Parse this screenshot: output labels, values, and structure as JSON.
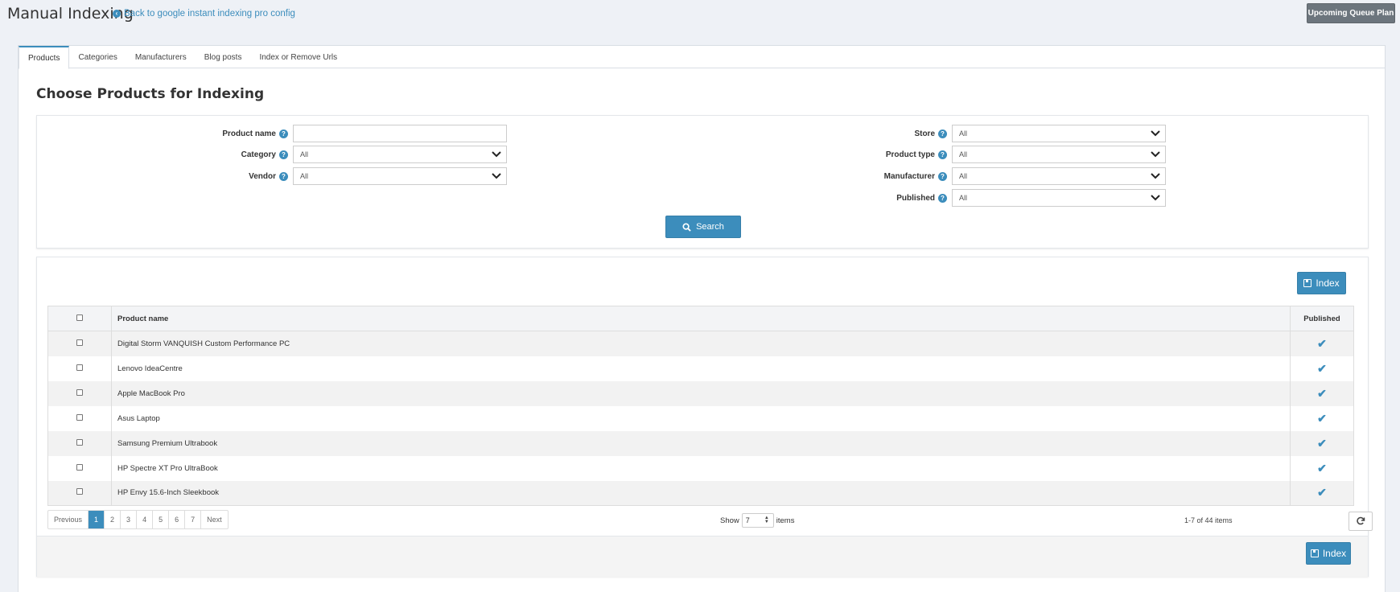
{
  "header": {
    "title": "Manual Indexing",
    "back_link": "Back to google instant indexing pro config",
    "queue_button": "Upcoming Queue Plan"
  },
  "tabs": [
    {
      "label": "Products"
    },
    {
      "label": "Categories"
    },
    {
      "label": "Manufacturers"
    },
    {
      "label": "Blog posts"
    },
    {
      "label": "Index or Remove Urls"
    }
  ],
  "section_title": "Choose Products for Indexing",
  "filters": {
    "product_name": {
      "label": "Product name",
      "value": ""
    },
    "category": {
      "label": "Category",
      "value": "All"
    },
    "vendor": {
      "label": "Vendor",
      "value": "All"
    },
    "store": {
      "label": "Store",
      "value": "All"
    },
    "product_type": {
      "label": "Product type",
      "value": "All"
    },
    "manufacturer": {
      "label": "Manufacturer",
      "value": "All"
    },
    "published": {
      "label": "Published",
      "value": "All"
    }
  },
  "search_button": "Search",
  "index_button": "Index",
  "table": {
    "columns": [
      "Product name",
      "Published"
    ],
    "rows": [
      {
        "name": "Digital Storm VANQUISH Custom Performance PC",
        "published": true
      },
      {
        "name": "Lenovo IdeaCentre",
        "published": true
      },
      {
        "name": "Apple MacBook Pro",
        "published": true
      },
      {
        "name": "Asus Laptop",
        "published": true
      },
      {
        "name": "Samsung Premium Ultrabook",
        "published": true
      },
      {
        "name": "HP Spectre XT Pro UltraBook",
        "published": true
      },
      {
        "name": "HP Envy 15.6-Inch Sleekbook",
        "published": true
      }
    ]
  },
  "pagination": {
    "previous": "Previous",
    "pages": [
      "1",
      "2",
      "3",
      "4",
      "5",
      "6",
      "7"
    ],
    "current": "1",
    "next": "Next",
    "show_label": "Show",
    "page_size": "7",
    "items_label": "items",
    "range_text": "1-7 of 44 items"
  },
  "colors": {
    "accent": "#3c8dbc",
    "queue_button": "#6c757d",
    "background": "#eef1f6"
  }
}
